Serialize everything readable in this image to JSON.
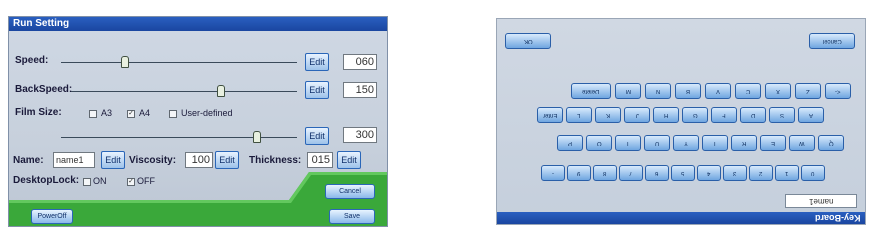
{
  "run_setting": {
    "title": "Run Setting",
    "speed": {
      "label": "Speed:",
      "edit": "Edit",
      "value": "060"
    },
    "backspeed": {
      "label": "BackSpeed:",
      "edit": "Edit",
      "value": "150"
    },
    "film_size": {
      "label": "Film Size:",
      "options": [
        "A3",
        "A4",
        "User-defined"
      ],
      "checked": "A4",
      "check_mark": "✓",
      "edit": "Edit",
      "value": "300"
    },
    "name": {
      "label": "Name:",
      "value": "name1",
      "edit": "Edit"
    },
    "viscosity": {
      "label": "Viscosity:",
      "value": "100",
      "edit": "Edit"
    },
    "thickness": {
      "label": "Thickness:",
      "value": "015",
      "edit": "Edit"
    },
    "desktop_lock": {
      "label": "DesktopLock:",
      "on": "ON",
      "off": "OFF",
      "checked": "OFF"
    },
    "buttons": {
      "poweroff": "PowerOff",
      "cancel": "Cancel",
      "save": "Save"
    }
  },
  "keyboard": {
    "title": "Key-Board",
    "ok": "OK",
    "cancel": "Cancel",
    "field_value": "name1",
    "row1": [
      "Delete",
      "M",
      "N",
      "B",
      "V",
      "C",
      "X",
      "Z",
      "<-"
    ],
    "row2": [
      "Enter",
      "L",
      "K",
      "J",
      "H",
      "G",
      "F",
      "D",
      "S",
      "A"
    ],
    "row3": [
      "P",
      "O",
      "I",
      "U",
      "Y",
      "T",
      "R",
      "E",
      "W",
      "Q"
    ],
    "row4": [
      "-",
      "9",
      "8",
      "7",
      "6",
      "5",
      "4",
      "3",
      "2",
      "1",
      "0"
    ]
  },
  "colors": {
    "title_bar": "#1a46a0",
    "button_border": "#2a66b8",
    "green_bar": "#3aa83a"
  }
}
